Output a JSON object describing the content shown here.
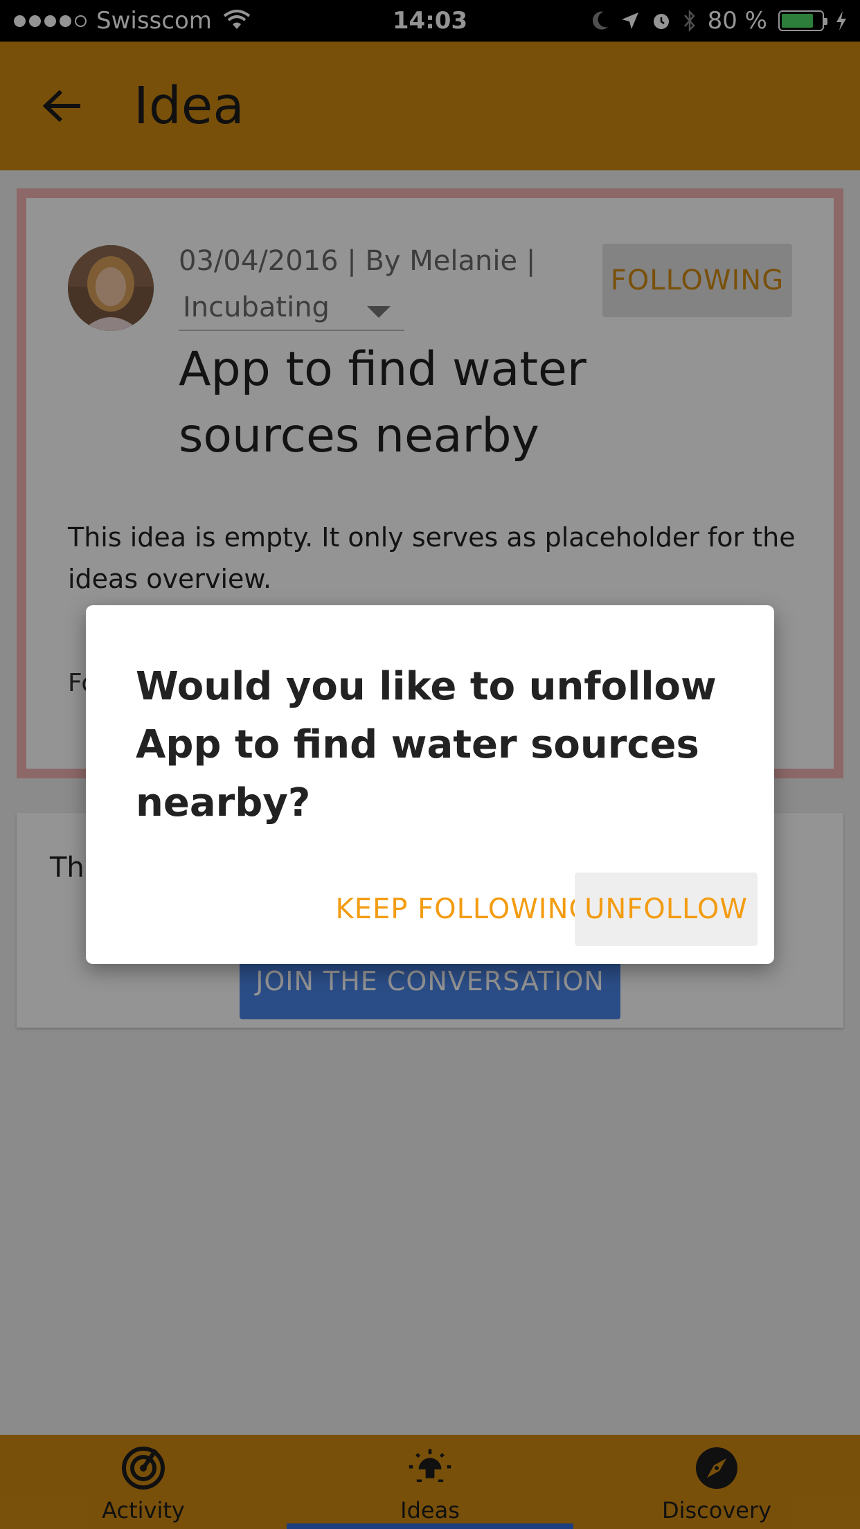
{
  "status_bar": {
    "carrier": "Swisscom",
    "time": "14:03",
    "battery": "80 %",
    "battery_level": 0.8
  },
  "app_bar": {
    "title": "Idea",
    "back_icon": "arrow-back-icon"
  },
  "idea": {
    "meta": "03/04/2016 | By Melanie |",
    "status": "Incubating",
    "follow_label": "FOLLOWING",
    "title": "App to find water sources nearby",
    "description": "This idea is empty. It only serves as placeholder for the ideas overview.",
    "followers_snippet": "Fo"
  },
  "conversation_card": {
    "snippet": "Th",
    "join_label": "JOIN THE CONVERSATION"
  },
  "dialog": {
    "message": "Would you like to unfollow App to find water sources nearby?",
    "keep_label": "KEEP FOLLOWING",
    "unfollow_label": "UNFOLLOW"
  },
  "bottom_nav": {
    "items": [
      {
        "label": "Activity",
        "icon": "radar-icon"
      },
      {
        "label": "Ideas",
        "icon": "lightbulb-icon"
      },
      {
        "label": "Discovery",
        "icon": "compass-icon"
      }
    ],
    "active": "Ideas"
  },
  "colors": {
    "accent": "#d18b12",
    "dialog_action": "#f39c12",
    "primary_button": "#4a86e8",
    "nav_indicator": "#2f6bdc"
  }
}
